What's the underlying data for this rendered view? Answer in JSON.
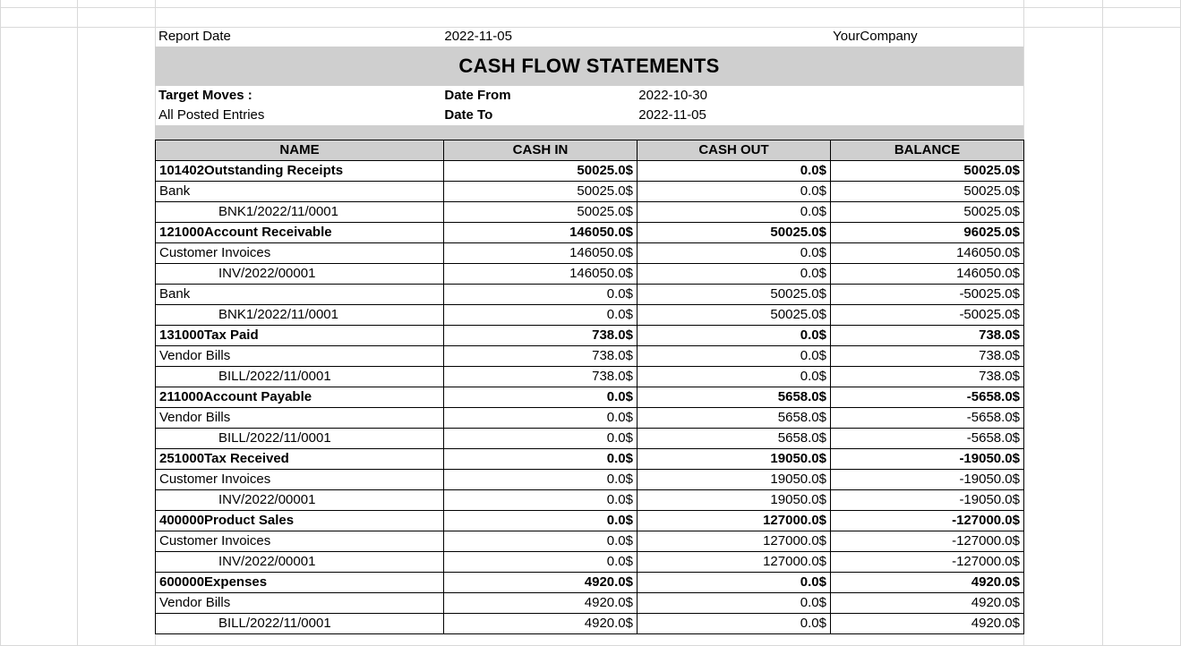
{
  "header": {
    "report_date_label": "Report Date",
    "report_date_value": "2022-11-05",
    "company": "YourCompany",
    "title": "CASH FLOW STATEMENTS",
    "target_moves_label": "Target Moves :",
    "target_moves_value": "All Posted Entries",
    "date_from_label": "Date From",
    "date_from_value": "2022-10-30",
    "date_to_label": "Date To",
    "date_to_value": "2022-11-05"
  },
  "columns": {
    "name": "NAME",
    "cash_in": "CASH IN",
    "cash_out": "CASH OUT",
    "balance": "BALANCE"
  },
  "rows": [
    {
      "level": 0,
      "name": "101402Outstanding Receipts",
      "cash_in": "50025.0$",
      "cash_out": "0.0$",
      "balance": "50025.0$"
    },
    {
      "level": 1,
      "name": "Bank",
      "cash_in": "50025.0$",
      "cash_out": "0.0$",
      "balance": "50025.0$"
    },
    {
      "level": 2,
      "name": "BNK1/2022/11/0001",
      "cash_in": "50025.0$",
      "cash_out": "0.0$",
      "balance": "50025.0$"
    },
    {
      "level": 0,
      "name": "121000Account Receivable",
      "cash_in": "146050.0$",
      "cash_out": "50025.0$",
      "balance": "96025.0$"
    },
    {
      "level": 1,
      "name": "Customer Invoices",
      "cash_in": "146050.0$",
      "cash_out": "0.0$",
      "balance": "146050.0$"
    },
    {
      "level": 2,
      "name": "INV/2022/00001",
      "cash_in": "146050.0$",
      "cash_out": "0.0$",
      "balance": "146050.0$"
    },
    {
      "level": 1,
      "name": "Bank",
      "cash_in": "0.0$",
      "cash_out": "50025.0$",
      "balance": "-50025.0$"
    },
    {
      "level": 2,
      "name": "BNK1/2022/11/0001",
      "cash_in": "0.0$",
      "cash_out": "50025.0$",
      "balance": "-50025.0$"
    },
    {
      "level": 0,
      "name": "131000Tax Paid",
      "cash_in": "738.0$",
      "cash_out": "0.0$",
      "balance": "738.0$"
    },
    {
      "level": 1,
      "name": "Vendor Bills",
      "cash_in": "738.0$",
      "cash_out": "0.0$",
      "balance": "738.0$"
    },
    {
      "level": 2,
      "name": "BILL/2022/11/0001",
      "cash_in": "738.0$",
      "cash_out": "0.0$",
      "balance": "738.0$"
    },
    {
      "level": 0,
      "name": "211000Account Payable",
      "cash_in": "0.0$",
      "cash_out": "5658.0$",
      "balance": "-5658.0$"
    },
    {
      "level": 1,
      "name": "Vendor Bills",
      "cash_in": "0.0$",
      "cash_out": "5658.0$",
      "balance": "-5658.0$"
    },
    {
      "level": 2,
      "name": "BILL/2022/11/0001",
      "cash_in": "0.0$",
      "cash_out": "5658.0$",
      "balance": "-5658.0$"
    },
    {
      "level": 0,
      "name": "251000Tax Received",
      "cash_in": "0.0$",
      "cash_out": "19050.0$",
      "balance": "-19050.0$"
    },
    {
      "level": 1,
      "name": "Customer Invoices",
      "cash_in": "0.0$",
      "cash_out": "19050.0$",
      "balance": "-19050.0$"
    },
    {
      "level": 2,
      "name": "INV/2022/00001",
      "cash_in": "0.0$",
      "cash_out": "19050.0$",
      "balance": "-19050.0$"
    },
    {
      "level": 0,
      "name": "400000Product Sales",
      "cash_in": "0.0$",
      "cash_out": "127000.0$",
      "balance": "-127000.0$"
    },
    {
      "level": 1,
      "name": "Customer Invoices",
      "cash_in": "0.0$",
      "cash_out": "127000.0$",
      "balance": "-127000.0$"
    },
    {
      "level": 2,
      "name": "INV/2022/00001",
      "cash_in": "0.0$",
      "cash_out": "127000.0$",
      "balance": "-127000.0$"
    },
    {
      "level": 0,
      "name": "600000Expenses",
      "cash_in": "4920.0$",
      "cash_out": "0.0$",
      "balance": "4920.0$"
    },
    {
      "level": 1,
      "name": "Vendor Bills",
      "cash_in": "4920.0$",
      "cash_out": "0.0$",
      "balance": "4920.0$"
    },
    {
      "level": 2,
      "name": "BILL/2022/11/0001",
      "cash_in": "4920.0$",
      "cash_out": "0.0$",
      "balance": "4920.0$"
    }
  ]
}
